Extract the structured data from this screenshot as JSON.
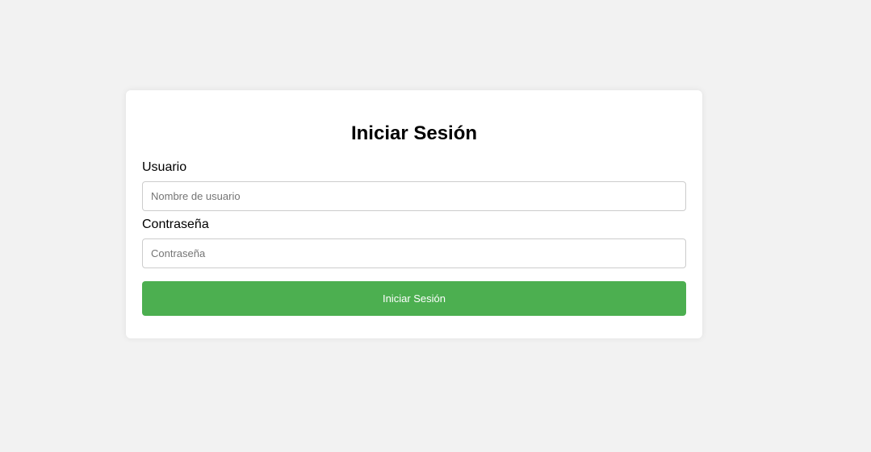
{
  "colors": {
    "background": "#f2f2f2",
    "card": "#ffffff",
    "button": "#4caf50",
    "button_text": "#ffffff"
  },
  "login": {
    "title": "Iniciar Sesión",
    "username_label": "Usuario",
    "username_value": "",
    "username_placeholder": "Nombre de usuario",
    "password_label": "Contraseña",
    "password_value": "",
    "password_placeholder": "Contraseña",
    "submit_label": "Iniciar Sesión"
  }
}
